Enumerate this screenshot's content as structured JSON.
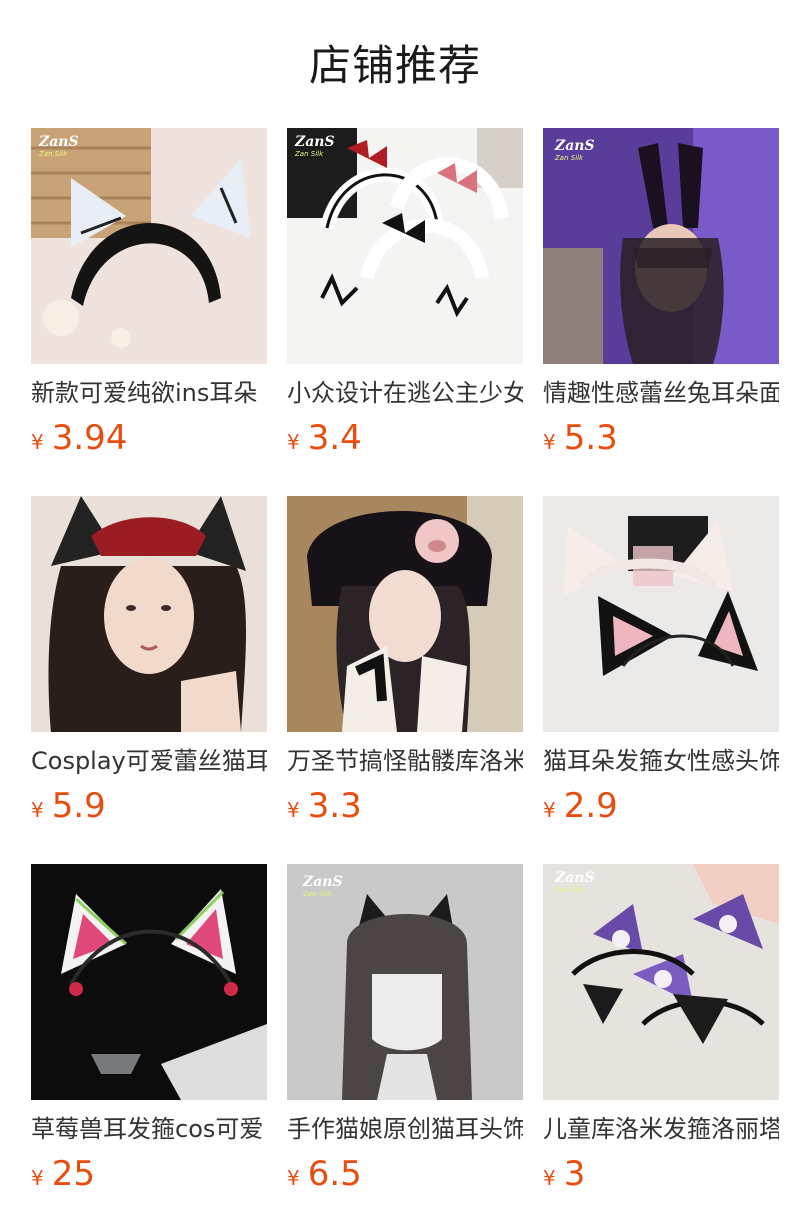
{
  "section": {
    "title": "店铺推荐"
  },
  "products": [
    {
      "name": "新款可爱纯欲ins耳朵",
      "currency": "¥",
      "price": "3.94",
      "watermark": "ZanS",
      "watermark_sub": "Zan Silk"
    },
    {
      "name": "小众设计在逃公主少女",
      "currency": "¥",
      "price": "3.4",
      "watermark": "ZanS",
      "watermark_sub": "Zan Silk"
    },
    {
      "name": "情趣性感蕾丝兔耳朵面",
      "currency": "¥",
      "price": "5.3",
      "watermark": "ZanS",
      "watermark_sub": "Zan Silk"
    },
    {
      "name": "Cosplay可爱蕾丝猫耳",
      "currency": "¥",
      "price": "5.9"
    },
    {
      "name": "万圣节搞怪骷髅库洛米",
      "currency": "¥",
      "price": "3.3"
    },
    {
      "name": "猫耳朵发箍女性感头饰",
      "currency": "¥",
      "price": "2.9"
    },
    {
      "name": "草莓兽耳发箍cos可爱",
      "currency": "¥",
      "price": "25"
    },
    {
      "name": "手作猫娘原创猫耳头饰",
      "currency": "¥",
      "price": "6.5",
      "watermark": "ZanS",
      "watermark_sub": "Zan Silk"
    },
    {
      "name": "儿童库洛米发箍洛丽塔",
      "currency": "¥",
      "price": "3",
      "watermark": "ZanS",
      "watermark_sub": "Zan Silk"
    }
  ]
}
